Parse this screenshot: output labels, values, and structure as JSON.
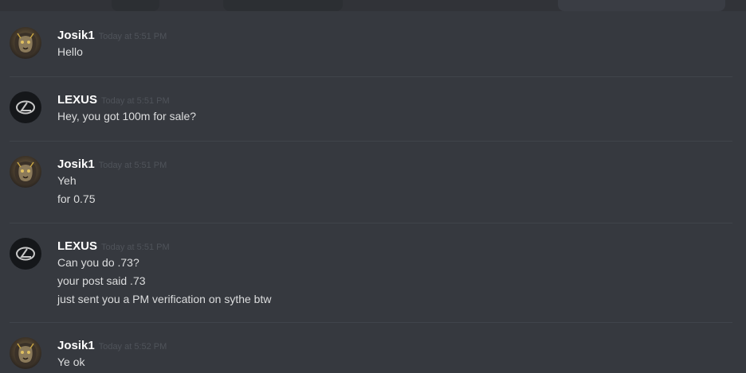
{
  "messages": [
    {
      "author": "Josik1",
      "avatar_icon": "lion-avatar-icon",
      "timestamp": "Today at 5:51 PM",
      "lines": [
        "Hello"
      ]
    },
    {
      "author": "LEXUS",
      "avatar_icon": "lexus-logo-avatar-icon",
      "timestamp": "Today at 5:51 PM",
      "lines": [
        "Hey, you got 100m for sale?"
      ]
    },
    {
      "author": "Josik1",
      "avatar_icon": "lion-avatar-icon",
      "timestamp": "Today at 5:51 PM",
      "lines": [
        "Yeh",
        "for 0.75"
      ]
    },
    {
      "author": "LEXUS",
      "avatar_icon": "lexus-logo-avatar-icon",
      "timestamp": "Today at 5:51 PM",
      "lines": [
        "Can you do .73?",
        "your post said .73",
        "just sent you a PM verification on sythe btw"
      ]
    },
    {
      "author": "Josik1",
      "avatar_icon": "lion-avatar-icon",
      "timestamp": "Today at 5:52 PM",
      "lines": [
        "Ye ok"
      ]
    }
  ],
  "colors": {
    "background": "#36393f",
    "username": "#ffffff",
    "timestamp": "#4f535a",
    "message_text": "#dcddde",
    "divider": "#40444b"
  }
}
